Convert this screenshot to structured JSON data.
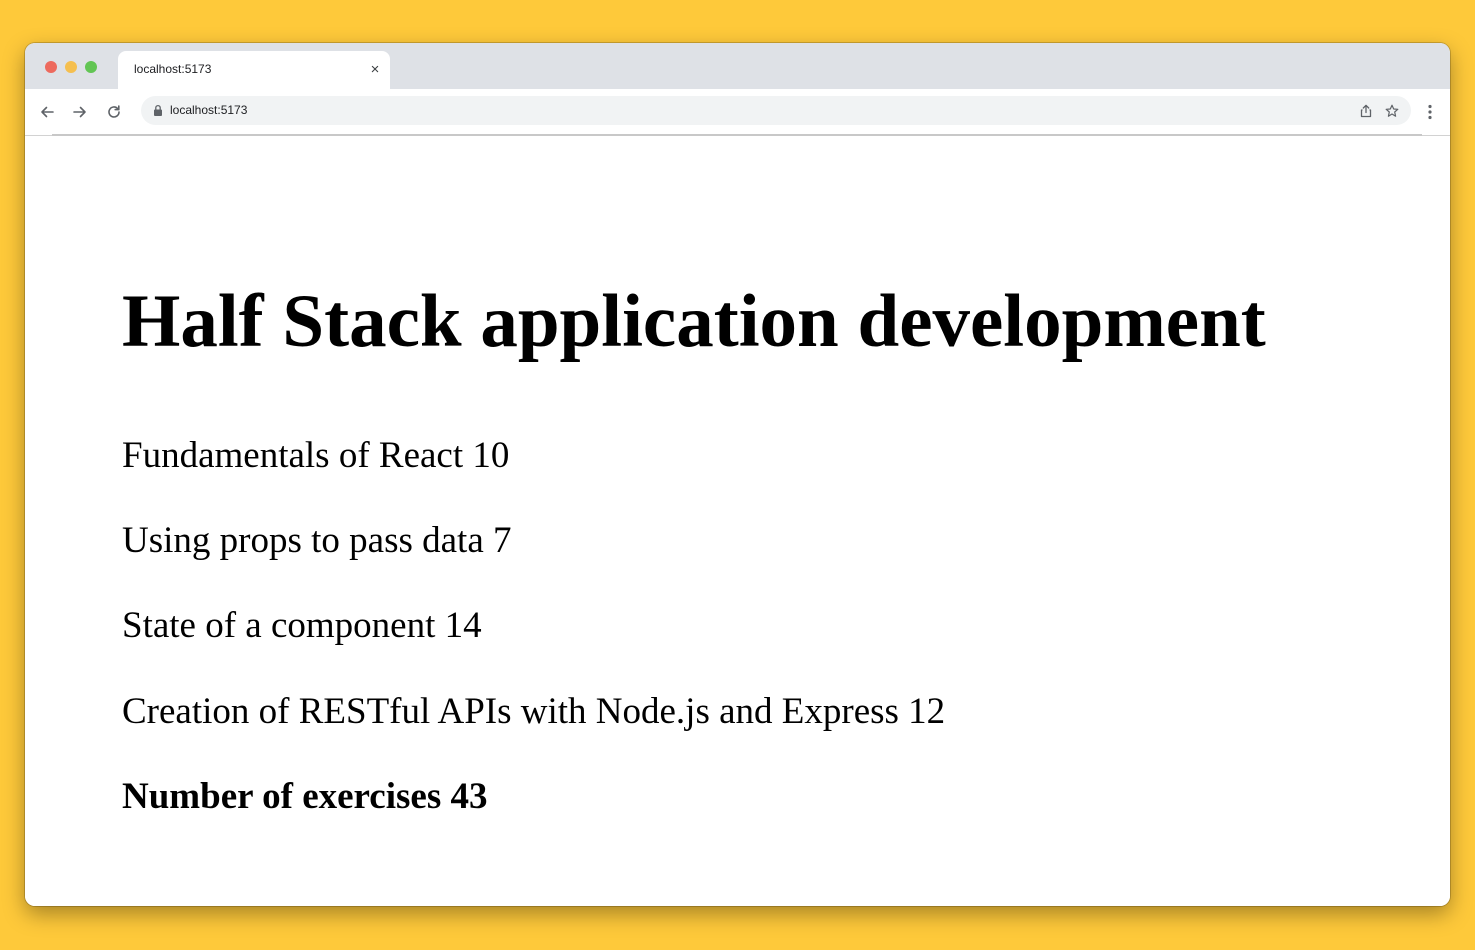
{
  "browser": {
    "tab": {
      "title": "localhost:5173",
      "close_icon": "×"
    },
    "address_bar": {
      "url": "localhost:5173"
    },
    "icons": {
      "back": "arrow-left-icon",
      "forward": "arrow-right-icon",
      "reload": "reload-icon",
      "lock": "lock-icon",
      "share": "share-icon",
      "bookmark": "star-icon",
      "menu": "kebab-menu-icon"
    }
  },
  "page": {
    "heading": "Half Stack application development",
    "parts": [
      {
        "name": "Fundamentals of React",
        "exercises": 10,
        "text": "Fundamentals of React 10"
      },
      {
        "name": "Using props to pass data",
        "exercises": 7,
        "text": "Using props to pass data 7"
      },
      {
        "name": "State of a component",
        "exercises": 14,
        "text": "State of a component 14"
      },
      {
        "name": "Creation of RESTful APIs with Node.js and Express",
        "exercises": 12,
        "text": "Creation of RESTful APIs with Node.js and Express 12"
      }
    ],
    "total_text": "Number of exercises 43"
  },
  "colors": {
    "background": "#fec93a",
    "tabstrip": "#dee1e6",
    "omnibox": "#f1f3f4",
    "traffic_close": "#ed6a5e",
    "traffic_minimize": "#f5bf4f",
    "traffic_maximize": "#62c554"
  }
}
